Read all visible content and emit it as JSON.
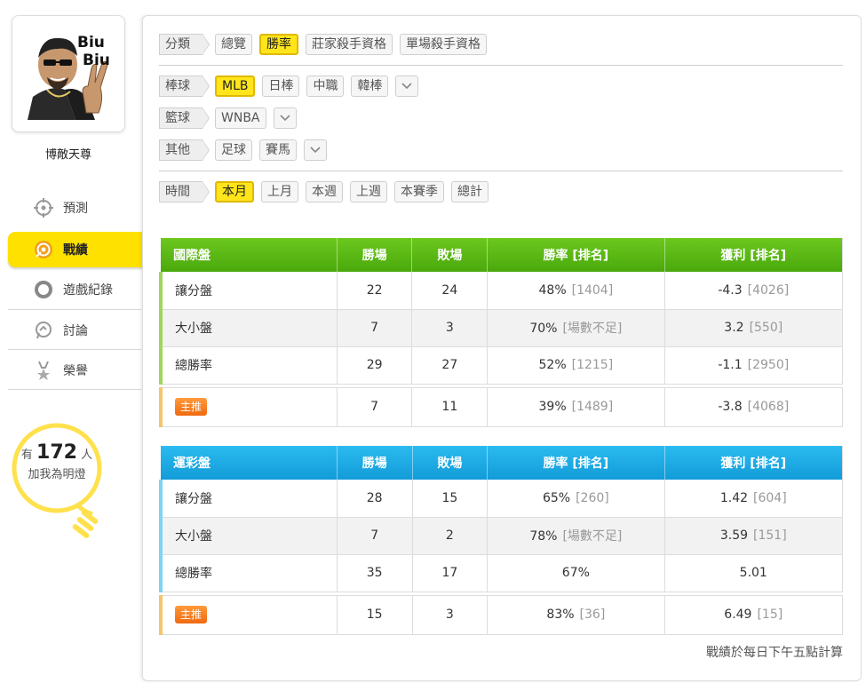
{
  "user": {
    "avatar_text": "Biu\nBiu",
    "name": "博敵天尊"
  },
  "nav": [
    {
      "label": "預測",
      "icon": "crosshair-icon",
      "active": false
    },
    {
      "label": "戰績",
      "icon": "target-icon",
      "active": true
    },
    {
      "label": "遊戲紀錄",
      "icon": "circle-icon",
      "active": false
    },
    {
      "label": "討論",
      "icon": "chat-icon",
      "active": false
    },
    {
      "label": "榮譽",
      "icon": "medal-icon",
      "active": false
    }
  ],
  "fans": {
    "prefix": "有",
    "count": "172",
    "suffix": "人",
    "line2": "加我為明燈"
  },
  "filters": {
    "category": {
      "label": "分類",
      "options": [
        "總覽",
        "勝率",
        "莊家殺手資格",
        "單場殺手資格"
      ],
      "active": "勝率"
    },
    "baseball": {
      "label": "棒球",
      "options": [
        "MLB",
        "日棒",
        "中職",
        "韓棒"
      ],
      "active": "MLB"
    },
    "basketball": {
      "label": "籃球",
      "options": [
        "WNBA"
      ],
      "active": ""
    },
    "other": {
      "label": "其他",
      "options": [
        "足球",
        "賽馬"
      ],
      "active": ""
    },
    "time": {
      "label": "時間",
      "options": [
        "本月",
        "上月",
        "本週",
        "上週",
        "本賽季",
        "總計"
      ],
      "active": "本月"
    }
  },
  "tables": [
    {
      "title": "國際盤",
      "headers": [
        "勝場",
        "敗場",
        "勝率 [排名]",
        "獲利 [排名]"
      ],
      "rows": [
        {
          "name": "讓分盤",
          "win": "22",
          "loss": "24",
          "rate": "48%",
          "rate_rank": "[1404]",
          "profit": "-4.3",
          "profit_rank": "[4026]"
        },
        {
          "name": "大小盤",
          "win": "7",
          "loss": "3",
          "rate": "70%",
          "rate_rank": "[場數不足]",
          "profit": "3.2",
          "profit_rank": "[550]"
        },
        {
          "name": "總勝率",
          "win": "29",
          "loss": "27",
          "rate": "52%",
          "rate_rank": "[1215]",
          "profit": "-1.1",
          "profit_rank": "[2950]"
        }
      ],
      "main": {
        "badge": "主推",
        "win": "7",
        "loss": "11",
        "rate": "39%",
        "rate_rank": "[1489]",
        "profit": "-3.8",
        "profit_rank": "[4068]"
      }
    },
    {
      "title": "運彩盤",
      "headers": [
        "勝場",
        "敗場",
        "勝率 [排名]",
        "獲利 [排名]"
      ],
      "rows": [
        {
          "name": "讓分盤",
          "win": "28",
          "loss": "15",
          "rate": "65%",
          "rate_rank": "[260]",
          "profit": "1.42",
          "profit_rank": "[604]"
        },
        {
          "name": "大小盤",
          "win": "7",
          "loss": "2",
          "rate": "78%",
          "rate_rank": "[場數不足]",
          "profit": "3.59",
          "profit_rank": "[151]"
        },
        {
          "name": "總勝率",
          "win": "35",
          "loss": "17",
          "rate": "67%",
          "rate_rank": "",
          "profit": "5.01",
          "profit_rank": ""
        }
      ],
      "main": {
        "badge": "主推",
        "win": "15",
        "loss": "3",
        "rate": "83%",
        "rate_rank": "[36]",
        "profit": "6.49",
        "profit_rank": "[15]"
      }
    }
  ],
  "note": "戰績於每日下午五點計算",
  "colors": {
    "accent_yellow": "#ffe100",
    "green_header": "#5ab914",
    "blue_header": "#1aa8e2",
    "badge_orange": "#f37a1c"
  }
}
